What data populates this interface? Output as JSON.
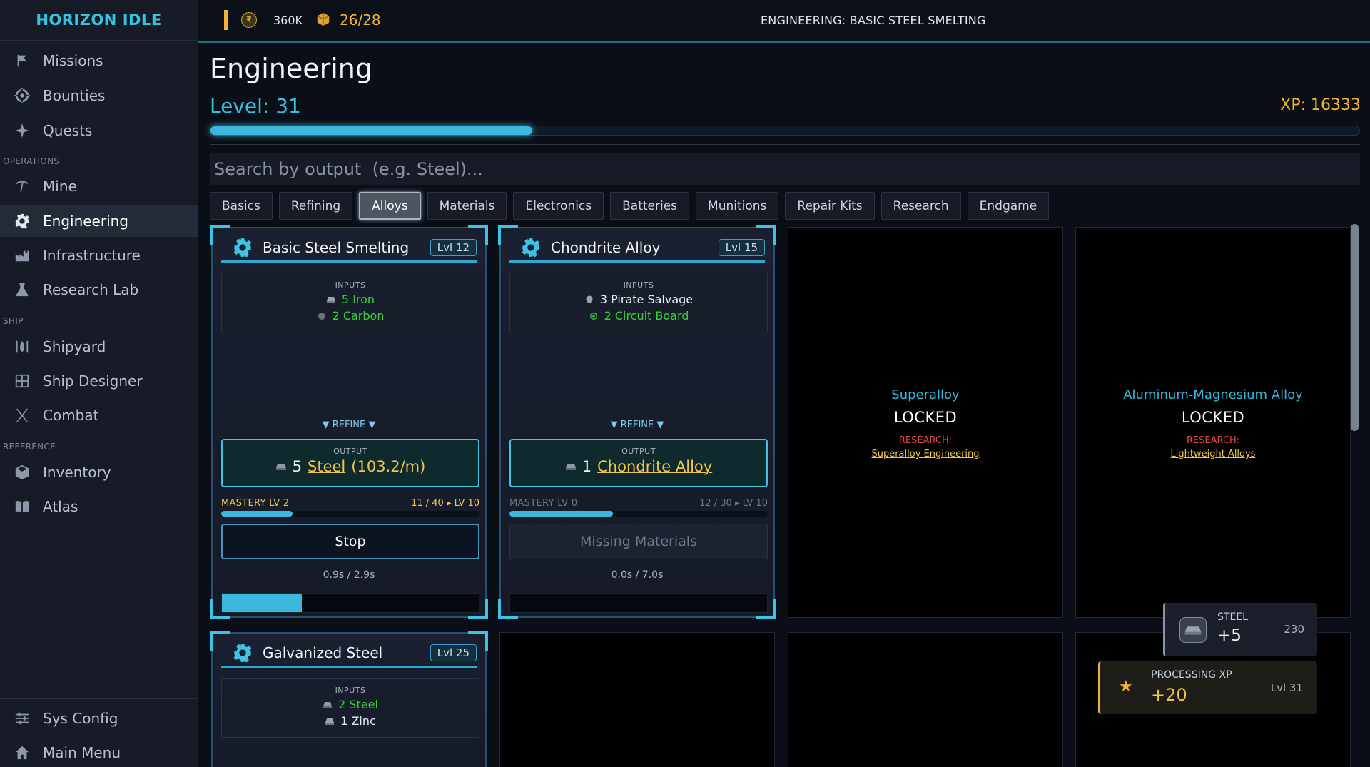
{
  "app": {
    "title": "HORIZON IDLE"
  },
  "sidebar": {
    "items": [
      {
        "label": "Missions",
        "icon": "flag-icon"
      },
      {
        "label": "Bounties",
        "icon": "target-icon"
      },
      {
        "label": "Quests",
        "icon": "sparkle-icon"
      },
      {
        "label": "Mine",
        "icon": "pickaxe-icon"
      },
      {
        "label": "Engineering",
        "icon": "gear-icon",
        "active": true
      },
      {
        "label": "Infrastructure",
        "icon": "factory-icon"
      },
      {
        "label": "Research Lab",
        "icon": "flask-icon"
      },
      {
        "label": "Shipyard",
        "icon": "shipyard-icon"
      },
      {
        "label": "Ship Designer",
        "icon": "grid-icon"
      },
      {
        "label": "Combat",
        "icon": "swords-icon"
      },
      {
        "label": "Inventory",
        "icon": "cube-icon"
      },
      {
        "label": "Atlas",
        "icon": "book-icon"
      },
      {
        "label": "Sys Config",
        "icon": "sliders-icon"
      },
      {
        "label": "Main Menu",
        "icon": "home-icon"
      }
    ],
    "sections": {
      "operations": "OPERATIONS",
      "ship": "SHIP",
      "reference": "REFERENCE"
    }
  },
  "topbar": {
    "credits": "360K",
    "cargo": "26/28",
    "activity": "ENGINEERING: BASIC STEEL SMELTING"
  },
  "page": {
    "title": "Engineering",
    "level": "Level: 31",
    "xp": "XP: 16333",
    "xp_progress": 0.28,
    "search_placeholder": "Search by output  (e.g. Steel)..."
  },
  "tabs": [
    "Basics",
    "Refining",
    "Alloys",
    "Materials",
    "Electronics",
    "Batteries",
    "Munitions",
    "Repair Kits",
    "Research",
    "Endgame"
  ],
  "active_tab": "Alloys",
  "recipes": [
    {
      "title": "Basic Steel Smelting",
      "level": "Lvl 12",
      "inputs_label": "INPUTS",
      "inputs": [
        {
          "text": "5 Iron",
          "icon": "ingot-icon"
        },
        {
          "text": "2 Carbon",
          "icon": "carbon-icon"
        }
      ],
      "refine": "▼ REFINE ▼",
      "output_label": "OUTPUT",
      "output": {
        "qty": "5",
        "name": "Steel",
        "rate": "(103.2/m)",
        "icon": "steel-icon"
      },
      "mastery_left": "MASTERY  LV 2",
      "mastery_right": "11 / 40  ▸  LV 10",
      "mastery_progress": 0.275,
      "action": "Stop",
      "timer": "0.9s / 2.9s",
      "progress": 0.31
    },
    {
      "title": "Chondrite Alloy",
      "level": "Lvl 15",
      "inputs_label": "INPUTS",
      "inputs": [
        {
          "text": "3 Pirate Salvage",
          "icon": "skull-icon"
        },
        {
          "text": "2 Circuit Board",
          "icon": "chip-icon"
        }
      ],
      "refine": "▼ REFINE ▼",
      "output_label": "OUTPUT",
      "output": {
        "qty": "1",
        "name": "Chondrite Alloy",
        "rate": "",
        "icon": "alloy-icon"
      },
      "mastery_left": "MASTERY  LV 0",
      "mastery_right": "12 / 30  ▸  LV 10",
      "mastery_progress": 0.4,
      "action": "Missing Materials",
      "timer": "0.0s / 7.0s",
      "progress": 0
    },
    {
      "title": "Galvanized Steel",
      "level": "Lvl 25",
      "inputs_label": "INPUTS",
      "inputs": [
        {
          "text": "2 Steel",
          "icon": "steel-icon"
        },
        {
          "text": "1 Zinc",
          "icon": "ingot-icon"
        }
      ]
    }
  ],
  "locked": [
    {
      "name": "Superalloy",
      "status": "LOCKED",
      "research_label": "RESEARCH:",
      "research": "Superalloy Engineering"
    },
    {
      "name": "Aluminum-Magnesium Alloy",
      "status": "LOCKED",
      "research_label": "RESEARCH:",
      "research": "Lightweight Alloys"
    }
  ],
  "toasts": {
    "steel": {
      "label": "STEEL",
      "value": "+5",
      "count": "230"
    },
    "xp": {
      "label": "PROCESSING XP",
      "value": "+20",
      "level": "Lvl 31"
    }
  },
  "colors": {
    "accent": "#3db7dd",
    "gold": "#f0b534",
    "green": "#36d436",
    "red": "#e04848"
  }
}
